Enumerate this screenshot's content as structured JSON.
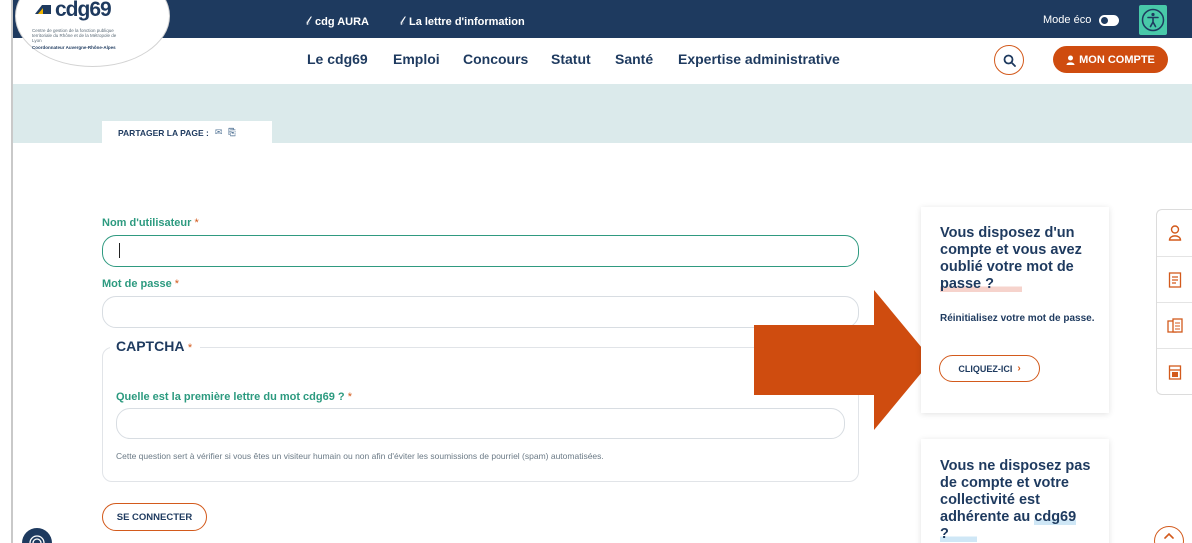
{
  "logo": {
    "text": "cdg69",
    "subtitle": "Centre de gestion de la fonction publique territoriale du Rhône et de la Métropole de Lyon",
    "coordinator": "Coordonnateur Auvergne-Rhône-Alpes"
  },
  "topbar": {
    "links": [
      {
        "label": "cdg AURA",
        "icon": "link-icon"
      },
      {
        "label": "La lettre d'information",
        "icon": "link-icon"
      }
    ],
    "eco_label": "Mode éco"
  },
  "nav": {
    "items": [
      "Le cdg69",
      "Emploi",
      "Concours",
      "Statut",
      "Santé",
      "Expertise administrative"
    ],
    "account_label": "MON COMPTE"
  },
  "share": {
    "label": "PARTAGER LA PAGE :"
  },
  "form": {
    "username_label": "Nom d'utilisateur",
    "password_label": "Mot de passe",
    "required_mark": "*",
    "captcha_legend": "CAPTCHA",
    "captcha_question": "Quelle est la première lettre du mot cdg69 ?",
    "captcha_help": "Cette question sert à vérifier si vous êtes un visiteur humain ou non afin d'éviter les soumissions de pourriel (spam) automatisées.",
    "submit_label": "SE CONNECTER"
  },
  "cards": {
    "forgot": {
      "title_start": "Vous disposez d'un compte et vous avez oublié votre mot de",
      "title_end": "passe ?",
      "text": "Réinitialisez votre mot de passe.",
      "button": "CLIQUEZ-ICI"
    },
    "no_account": {
      "title_start": "Vous ne disposez pas de compte et votre collectivité est adhérente au",
      "title_end": "cdg69 ?"
    }
  },
  "colors": {
    "navy": "#1e3a5f",
    "accent": "#cf4c0f",
    "teal": "#2c9a7f",
    "banner": "#dbeaeb"
  }
}
